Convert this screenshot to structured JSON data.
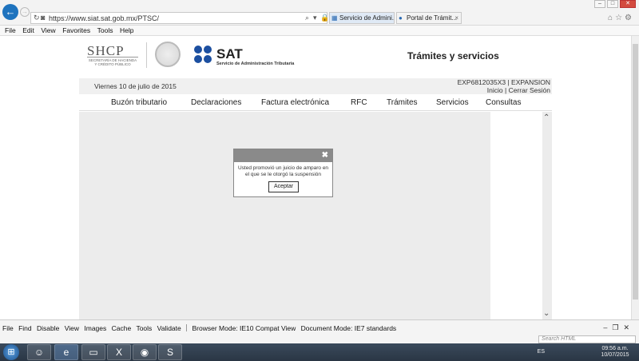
{
  "browser": {
    "url": "https://www.siat.sat.gob.mx/PTSC/",
    "tabs": [
      {
        "label": "Servicio de Admini...",
        "active": true
      },
      {
        "label": "Portal de Trámit...",
        "active": false
      }
    ],
    "menu": [
      "File",
      "Edit",
      "View",
      "Favorites",
      "Tools",
      "Help"
    ]
  },
  "site": {
    "shcp_logo": "SHCP",
    "shcp_subtitle": "SECRETARÍA DE HACIENDA Y CRÉDITO PÚBLICO",
    "sat_logo": "SAT",
    "sat_subtitle": "Servicio de Administración Tributaria",
    "section_title": "Trámites y servicios",
    "date": "Viernes 10 de julio de 2015",
    "user_id": "EXP6812035X3 | EXPANSION",
    "links": {
      "home": "Inicio",
      "separator": "|",
      "logout": "Cerrar Sesión"
    },
    "nav": [
      "Buzón tributario",
      "Declaraciones",
      "Factura electrónica",
      "RFC",
      "Trámites",
      "Servicios",
      "Consultas"
    ]
  },
  "dialog": {
    "message": "Usted promovió un juicio de amparo en el que se le otorgó la suspensión",
    "button": "Aceptar",
    "close": "✖"
  },
  "devtools": {
    "toolbar": [
      "File",
      "Find",
      "Disable",
      "View",
      "Images",
      "Cache",
      "Tools",
      "Validate"
    ],
    "browser_mode": "Browser Mode: IE10 Compat View",
    "document_mode": "Document Mode: IE7 standards",
    "search_placeholder": "Search HTML"
  },
  "taskbar": {
    "language": "ES",
    "time": "09:56 a.m.",
    "date": "10/07/2015"
  },
  "colors": {
    "sat_blue": "#1c4fa0",
    "ie_blue": "#1e73be",
    "dialog_header": "#8a8a8a"
  }
}
